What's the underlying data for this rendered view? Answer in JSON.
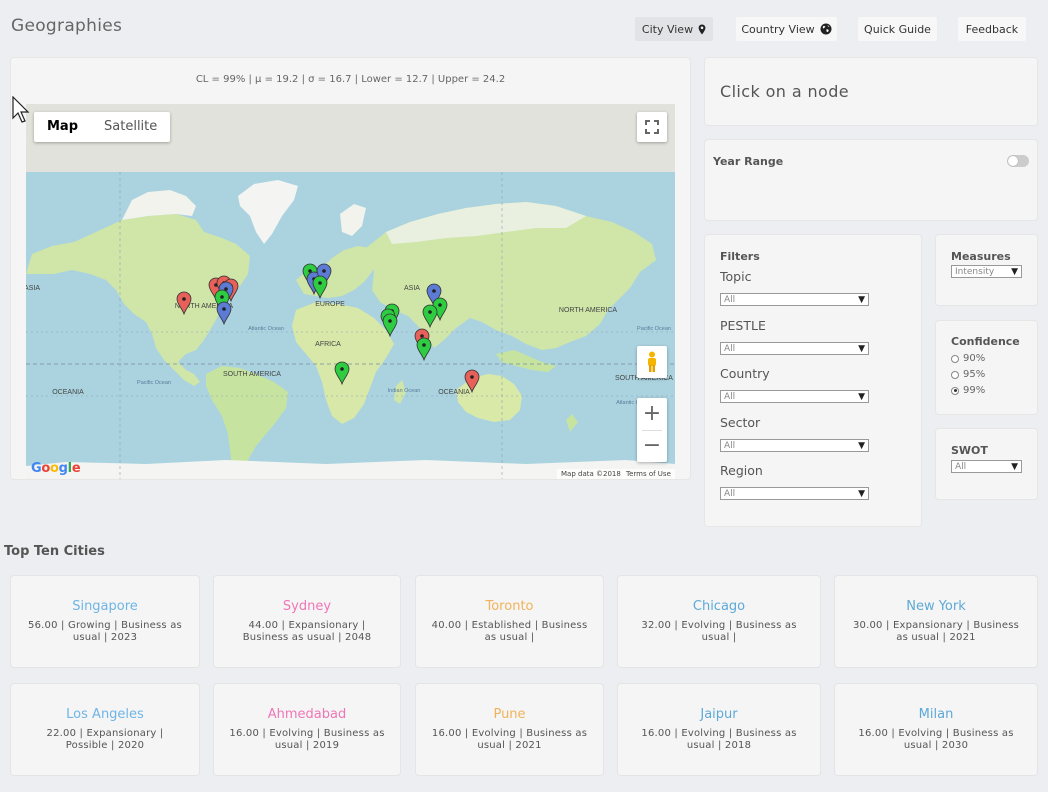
{
  "header": {
    "title": "Geographies",
    "buttons": {
      "city_view": "City View",
      "country_view": "Country View",
      "quick_guide": "Quick Guide",
      "feedback": "Feedback"
    }
  },
  "map_panel": {
    "stats": "CL = 99% | μ = 19.2 | σ = 16.7 | Lower = 12.7 | Upper = 24.2",
    "map_type": {
      "map": "Map",
      "satellite": "Satellite"
    },
    "zoom_in": "+",
    "zoom_out": "−",
    "google": "Google",
    "map_data": "Map data ©2018",
    "terms": "Terms of Use",
    "labels": {
      "north_america": "NORTH AMERICA",
      "south_america": "SOUTH AMERICA",
      "europe": "EUROPE",
      "africa": "AFRICA",
      "asia": "ASIA",
      "oceania": "OCEANIA",
      "atlantic": "Atlantic Ocean",
      "indian": "Indian Ocean",
      "pacific": "Pacific Ocean"
    },
    "marker_colors": {
      "red": "#e8605a",
      "green": "#2ecc40",
      "blue": "#5b7bd5"
    }
  },
  "info": {
    "prompt": "Click on a node"
  },
  "year_range": {
    "label": "Year Range",
    "enabled": false
  },
  "filters": {
    "title": "Filters",
    "items": [
      {
        "label": "Topic",
        "value": "All"
      },
      {
        "label": "PESTLE",
        "value": "All"
      },
      {
        "label": "Country",
        "value": "All"
      },
      {
        "label": "Sector",
        "value": "All"
      },
      {
        "label": "Region",
        "value": "All"
      }
    ]
  },
  "measures": {
    "title": "Measures",
    "value": "Intensity"
  },
  "confidence": {
    "title": "Confidence",
    "options": [
      "90%",
      "95%",
      "99%"
    ],
    "selected": "99%"
  },
  "swot": {
    "title": "SWOT",
    "value": "All"
  },
  "top_cities": {
    "title": "Top Ten Cities",
    "cards": [
      {
        "name": "Singapore",
        "desc": "56.00 | Growing | Business as usual | 2023",
        "color": "#6eb5e6"
      },
      {
        "name": "Sydney",
        "desc": "44.00 | Expansionary | Business as usual | 2048",
        "color": "#ef76b6"
      },
      {
        "name": "Toronto",
        "desc": "40.00 | Established | Business as usual |",
        "color": "#f0b25a"
      },
      {
        "name": "Chicago",
        "desc": "32.00 | Evolving | Business as usual |",
        "color": "#5da9d6"
      },
      {
        "name": "New York",
        "desc": "30.00 | Expansionary | Business as usual | 2021",
        "color": "#5da9d6"
      },
      {
        "name": "Los Angeles",
        "desc": "22.00 | Expansionary | Possible | 2020",
        "color": "#6eb5e6"
      },
      {
        "name": "Ahmedabad",
        "desc": "16.00 | Evolving | Business as usual | 2019",
        "color": "#ef76b6"
      },
      {
        "name": "Pune",
        "desc": "16.00 | Evolving | Business as usual | 2021",
        "color": "#f0b25a"
      },
      {
        "name": "Jaipur",
        "desc": "16.00 | Evolving | Business as usual | 2018",
        "color": "#5da9d6"
      },
      {
        "name": "Milan",
        "desc": "16.00 | Evolving | Business as usual | 2030",
        "color": "#5da9d6"
      }
    ]
  }
}
